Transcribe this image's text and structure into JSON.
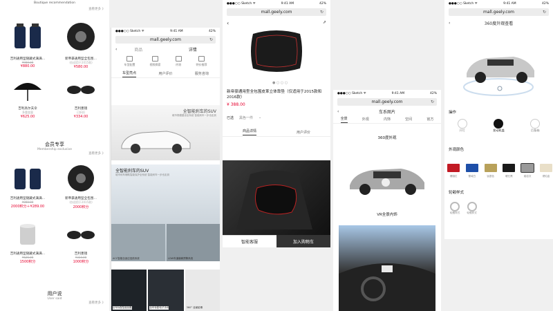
{
  "p1": {
    "section1_title": "Boutique recommendation",
    "more": "查看更多 》",
    "products": [
      {
        "name": "吉利通用型随藏式满满…",
        "old": "¥980.00",
        "price": "¥880.00"
      },
      {
        "name": "新帝豪通用型全包围…",
        "old": "(仅适用于2015款)",
        "price": "¥580.00"
      },
      {
        "name": "吉利高尔夫伞",
        "old": "多重变量",
        "price": "¥625.00"
      },
      {
        "name": "吉利墨镜",
        "old": "已折扣",
        "price": "¥334.00"
      }
    ],
    "section2_title": "会员专享",
    "section2_sub": "Membership exclusive",
    "member_products": [
      {
        "name": "吉利通用型随藏式满满…",
        "old": "¥980.00",
        "price": "2000积分＋¥289.00"
      },
      {
        "name": "新帝豪通用型全包围…",
        "old": "(仅适用于2015款)",
        "price": "2000积分"
      },
      {
        "name": "吉利通用型随藏式满满…",
        "old": "¥626.00",
        "price": "1500积分"
      },
      {
        "name": "吉利墨镜",
        "old": "¥334.00",
        "price": "1000积分"
      }
    ],
    "section3_title": "用户说",
    "section3_sub": "User said"
  },
  "p2": {
    "carrier": "●●●○○ Sketch ᯤ",
    "time": "9:41 AM",
    "battery": "42%",
    "url": "mall.geely.com",
    "nav": [
      "商品",
      "详情"
    ],
    "icons": [
      "车型配置",
      "视频探索",
      "评测",
      "特价推荐"
    ],
    "tabs": [
      "车型亮点",
      "用户评价",
      "服务咨询"
    ],
    "hero_caption": "全智能刹车的SUV",
    "hero_sub": "城市规模建设全系统 智能刹车一步也走到",
    "section_caption": "全智能刹车的SUV",
    "section_sub": "城市刹车辅助智能保护全系统 智能刹车一步也走到",
    "thumb_labels": [
      "ACC智能自适应巡航系统",
      "LDW车道偏离预警系统"
    ],
    "bottom_labels": [
      "全车标配智能钥匙",
      "全车标配电子手刹",
      "360° 全景影像"
    ]
  },
  "p3": {
    "carrier": "●●●○○ Sketch ᯤ",
    "time": "9:41 AM",
    "battery": "42%",
    "url": "mall.geely.com",
    "title": "新帝豪通用型全包围皮革立体靠垫（仅适用于2015款和2016款）",
    "price": "¥ 388.00",
    "selected_label": "已选",
    "selected_value": "黑色一件",
    "tabs": [
      "商品详情",
      "用户评价"
    ],
    "btn_service": "智能客服",
    "btn_cart": "加入购物车"
  },
  "p4": {
    "carrier": "●●●○○ Sketch ᯤ",
    "time": "9:41 AM",
    "battery": "42%",
    "url": "mall.geely.com",
    "title": "车系图片",
    "tabs": [
      "全景",
      "外观",
      "内饰",
      "空间",
      "官方"
    ],
    "caption1": "360度外观",
    "caption2": "VR全景内饰"
  },
  "p5": {
    "carrier": "●●●○○ Sketch ᯤ",
    "time": "9:41 AM",
    "battery": "42%",
    "url": "mall.geely.com",
    "title": "360度外观查看",
    "op_label": "操作",
    "ops": [
      "开灯",
      "发动机盖",
      "后备箱"
    ],
    "color_label": "外观颜色",
    "colors": [
      {
        "name": "珊瑚红",
        "hex": "#c21a24"
      },
      {
        "name": "雪域白",
        "hex": "#1e4fa8"
      },
      {
        "name": "钛银色",
        "hex": "#b8a15a"
      },
      {
        "name": "曜石黑",
        "hex": "#1a1a1a"
      },
      {
        "name": "熔岩灰",
        "hex": "#9a9a9a"
      },
      {
        "name": "琥珀金",
        "hex": "#e9dfc8"
      }
    ],
    "wheel_label": "轮毂样式",
    "wheels": [
      "轮毂样式",
      "轮毂样式"
    ]
  },
  "colors": {
    "accent": "#e6002d",
    "dark": "#333333"
  }
}
